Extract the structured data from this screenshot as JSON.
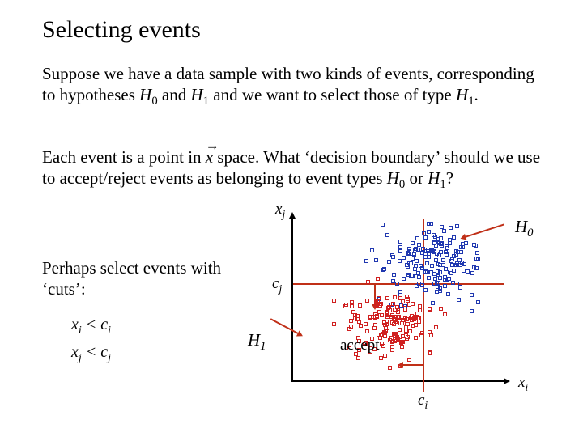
{
  "title": "Selecting events",
  "p1_a": "Suppose we have a data sample with two kinds of events, corresponding to hypotheses ",
  "p1_h0": "H",
  "p1_h0s": "0",
  "p1_b": " and ",
  "p1_h1": "H",
  "p1_h1s": "1",
  "p1_c": " and we want to select those of type ",
  "p1_d": ".",
  "p2_a": "Each event is a point in ",
  "p2_vec": "x",
  "p2_b": " space.  What ‘decision boundary’ should we use to accept/reject events as belonging to event types ",
  "p2_c": " or ",
  "p2_q": "?",
  "p3": "Perhaps select events with ‘cuts’:",
  "cond1_l": "x",
  "cond1_ls": "i",
  "cond1_op": " < ",
  "cond1_r": "c",
  "cond1_rs": "i",
  "cond2_l": "x",
  "cond2_ls": "j",
  "cond2_r": "c",
  "cond2_rs": "j",
  "axis_xj": "x",
  "axis_xjs": "j",
  "axis_cj": "c",
  "axis_cjs": "j",
  "axis_xi": "x",
  "axis_xis": "i",
  "axis_ci": "c",
  "axis_cis": "i",
  "plot_h0": "H",
  "plot_h0s": "0",
  "plot_h1": "H",
  "plot_h1s": "1",
  "accept": "accept",
  "chart_data": {
    "type": "scatter",
    "title": "",
    "xlabel": "x_i",
    "ylabel": "x_j",
    "xlim": [
      0,
      10
    ],
    "ylim": [
      0,
      10
    ],
    "cuts": {
      "c_i": 6.2,
      "c_j": 6.0
    },
    "accept_region": "x_i < c_i AND x_j < c_j",
    "series": [
      {
        "name": "H0",
        "marker": "open-square",
        "color": "#2038b0",
        "center": [
          6.5,
          7.5
        ],
        "spread": 2.0,
        "n_approx": 180
      },
      {
        "name": "H1",
        "marker": "open-square",
        "color": "#d02020",
        "center": [
          4.5,
          3.5
        ],
        "spread": 1.8,
        "n_approx": 180
      }
    ],
    "annotations": [
      {
        "text": "H0",
        "xy": [
          9.6,
          9.4
        ],
        "arrow_to": [
          8.0,
          9.0
        ]
      },
      {
        "text": "H1",
        "xy": [
          -1.5,
          3.2
        ],
        "arrow_to": [
          1.0,
          4.0
        ]
      },
      {
        "text": "accept",
        "xy": [
          2.5,
          2.5
        ]
      }
    ]
  }
}
